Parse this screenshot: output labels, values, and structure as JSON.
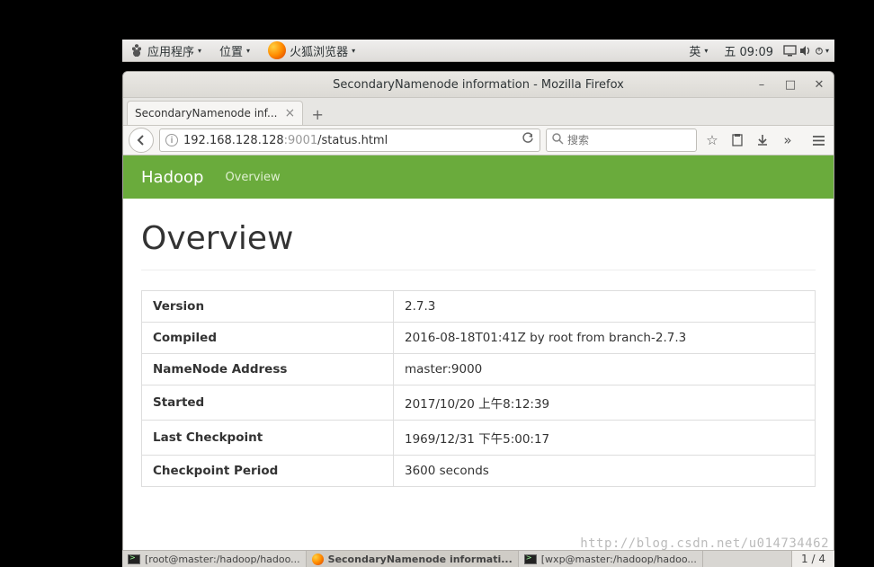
{
  "panel": {
    "apps_label": "应用程序",
    "places_label": "位置",
    "firefox_label": "火狐浏览器",
    "ime": "英",
    "date": "五 09:09"
  },
  "window": {
    "title": "SecondaryNamenode information - Mozilla Firefox",
    "tab_label": "SecondaryNamenode inf...",
    "url_host": "192.168.128.128",
    "url_port": ":9001",
    "url_path": "/status.html",
    "search_placeholder": "搜索"
  },
  "page": {
    "brand": "Hadoop",
    "nav_overview": "Overview",
    "heading": "Overview",
    "rows": [
      {
        "k": "Version",
        "v": "2.7.3"
      },
      {
        "k": "Compiled",
        "v": "2016-08-18T01:41Z by root from branch-2.7.3"
      },
      {
        "k": "NameNode Address",
        "v": "master:9000"
      },
      {
        "k": "Started",
        "v": "2017/10/20 上午8:12:39"
      },
      {
        "k": "Last Checkpoint",
        "v": "1969/12/31 下午5:00:17"
      },
      {
        "k": "Checkpoint Period",
        "v": "3600 seconds"
      }
    ]
  },
  "taskbar": {
    "item1": "[root@master:/hadoop/hadoo...",
    "item2": "SecondaryNamenode informati...",
    "item3": "[wxp@master:/hadoop/hadoo...",
    "pager": "1 / 4"
  },
  "watermark": "http://blog.csdn.net/u014734462"
}
